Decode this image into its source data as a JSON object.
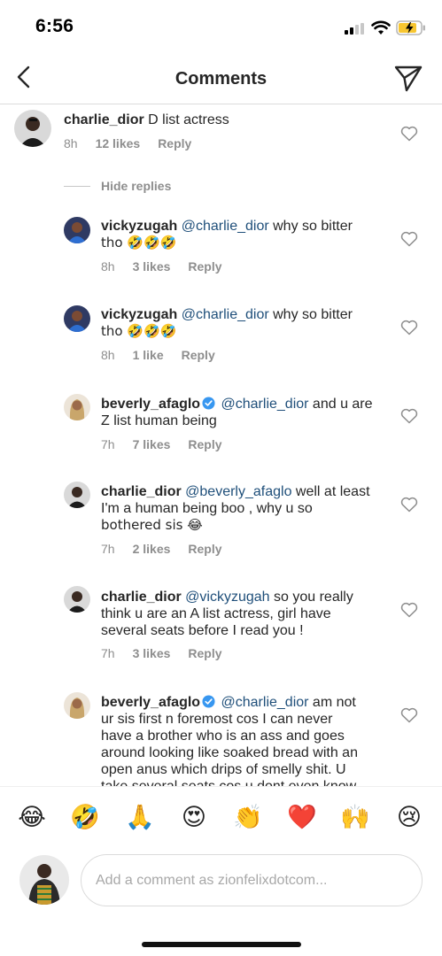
{
  "status_bar": {
    "time": "6:56"
  },
  "header": {
    "title": "Comments"
  },
  "hide_replies_label": "Hide replies",
  "comments": [
    {
      "username": "charlie_dior",
      "mention": "",
      "text": "D list actress",
      "text2": "",
      "time": "8h",
      "likes": "12 likes",
      "reply": "Reply"
    },
    {
      "username": "vickyzugah",
      "mention": "@charlie_dior",
      "text": "why so bitter",
      "text2": "tho 🤣🤣🤣",
      "time": "8h",
      "likes": "3 likes",
      "reply": "Reply"
    },
    {
      "username": "vickyzugah",
      "mention": "@charlie_dior",
      "text": "why so bitter",
      "text2": "tho 🤣🤣🤣",
      "time": "8h",
      "likes": "1 like",
      "reply": "Reply"
    },
    {
      "username": "beverly_afaglo",
      "mention": "@charlie_dior",
      "text": "and u are",
      "text2": "Z list human being",
      "time": "7h",
      "likes": "7 likes",
      "reply": "Reply",
      "verified": true
    },
    {
      "username": "charlie_dior",
      "mention": "@beverly_afaglo",
      "text": "well at least",
      "text2": "I'm a human being boo , why u so",
      "text3": "bothered sis 😂",
      "time": "7h",
      "likes": "2 likes",
      "reply": "Reply"
    },
    {
      "username": "charlie_dior",
      "mention": "@vickyzugah",
      "text": "so you really",
      "text2": "think u are an A list actress, girl have",
      "text3": "several seats before I read you !",
      "time": "7h",
      "likes": "3 likes",
      "reply": "Reply"
    },
    {
      "username": "beverly_afaglo",
      "mention": "@charlie_dior",
      "text": "am not",
      "text2": "ur sis first n foremost cos I can never",
      "text3": "have a brother who is an ass and goes",
      "text4": "around looking like soaked bread with an",
      "text5": "open anus which drips of smelly shit. U",
      "text6": "take several seats cos u dont even know",
      "verified": true
    }
  ],
  "emoji_bar": [
    "😂",
    "🤣",
    "🙏",
    "😍",
    "👏",
    "❤️",
    "🙌",
    "😢"
  ],
  "composer": {
    "placeholder": "Add a comment as zionfelixdotcom..."
  },
  "colors": {
    "mention": "#1f4f7a",
    "verified": "#3897f0",
    "meta": "#8e8e8e",
    "heart_red": "#ed1c24"
  },
  "icons": {
    "back": "chevron-left-icon",
    "send": "paper-plane-icon",
    "like": "heart-outline-icon",
    "verified": "verified-badge-icon"
  }
}
